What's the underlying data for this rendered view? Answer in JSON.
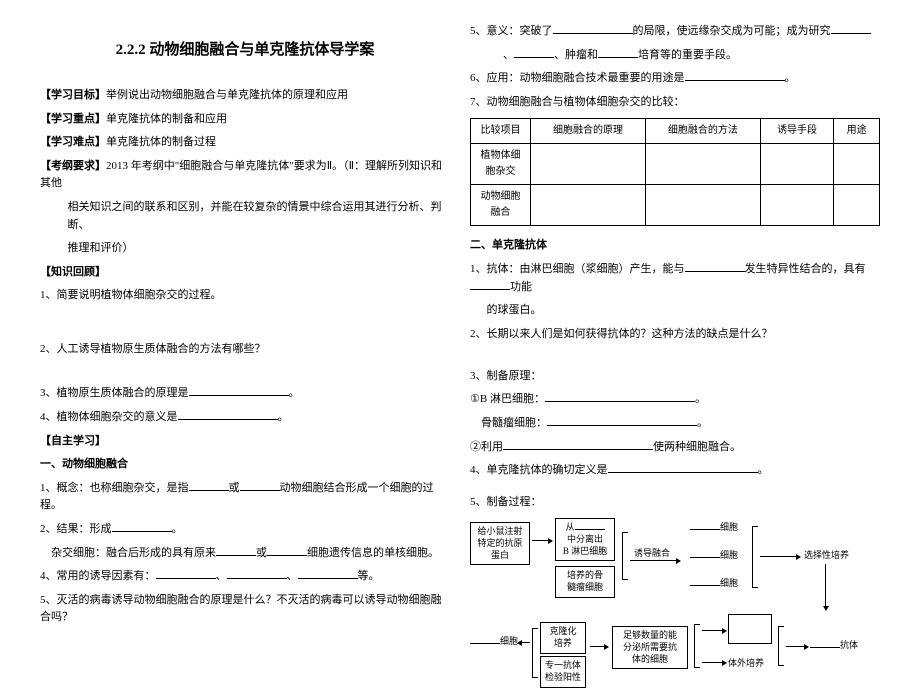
{
  "title": "2.2.2 动物细胞融合与单克隆抗体导学案",
  "left": {
    "goal_label": "【学习目标】",
    "goal": "举例说出动物细胞融合与单克隆抗体的原理和应用",
    "focus_label": "【学习重点】",
    "focus": "单克隆抗体的制备和应用",
    "diff_label": "【学习难点】",
    "diff": "单克隆抗体的制备过程",
    "req_label": "【考纲要求】",
    "req1": "2013 年考纲中\"细胞融合与单克隆抗体\"要求为Ⅱ。（Ⅱ：理解所列知识和其他",
    "req2": "相关知识之间的联系和区别，并能在较复杂的情景中综合运用其进行分析、判断、",
    "req3": "推理和评价）",
    "review_label": "【知识回顾】",
    "q1": "1、简要说明植物体细胞杂交的过程。",
    "q2": "2、人工诱导植物原生质体融合的方法有哪些？",
    "q3a": "3、植物原生质体融合的原理是",
    "q3b": "。",
    "q4a": "4、植物体细胞杂交的意义是",
    "q4b": "。",
    "self_label": "【自主学习】",
    "s1_title": "一、动物细胞融合",
    "s1_1a": "1、概念：也称细胞杂交，是指",
    "s1_1b": "或",
    "s1_1c": "动物细胞结合形成一个细胞的过程。",
    "s1_2a": "2、结果：形成",
    "s1_2b": "。",
    "s1_2c": "杂交细胞：融合后形成的具有原来",
    "s1_2d": "或",
    "s1_2e": "细胞遗传信息的单核细胞。",
    "s1_4a": "4、常用的诱导因素有：",
    "s1_4b": "、",
    "s1_4c": "、",
    "s1_4d": "等。",
    "s1_5": "5、灭活的病毒诱导动物细胞融合的原理是什么？不灭活的病毒可以诱导动物细胞融合吗？"
  },
  "right": {
    "r5a": "5、意义：突破了",
    "r5b": "的局限，使远缘杂交成为可能；成为研究",
    "r5c": "、",
    "r5d": "、肿瘤和",
    "r5e": "培育等的重要手段。",
    "r6a": "6、应用：动物细胞融合技术最重要的用途是",
    "r6b": "。",
    "r7": "7、动物细胞融合与植物体细胞杂交的比较：",
    "table": {
      "hdr": [
        "比较项目",
        "细胞融合的原理",
        "细胞融合的方法",
        "诱导手段",
        "用途"
      ],
      "row1": "植物体细胞杂交",
      "row2": "动物细胞融合"
    },
    "s2_title": "二、单克隆抗体",
    "s2_1a": "1、抗体：由淋巴细胞（浆细胞）产生，能与",
    "s2_1b": "发生特异性结合的，具有",
    "s2_1c": "功能",
    "s2_1d": "的球蛋白。",
    "s2_2": "2、长期以来人们是如何获得抗体的？这种方法的缺点是什么？",
    "s2_3": "3、制备原理：",
    "s2_3_1a": "①B 淋巴细胞：",
    "s2_3_1b": "。",
    "s2_3_1c": "骨髓瘤细胞：",
    "s2_3_1d": "。",
    "s2_3_2a": "②利用",
    "s2_3_2b": "使两种细胞融合。",
    "s2_4a": "4、单克隆抗体的确切定义是",
    "s2_4b": "。",
    "s2_5": "5、制备过程：",
    "flow": {
      "box1": "给小鼠注射\n特定的抗原\n蛋白",
      "box2a": "从",
      "box2b": "中分离出",
      "box2c": "B 淋巴细胞",
      "box3": "培养的骨\n髓瘤细胞",
      "label_induce": "诱导融合",
      "cell_suffix": "细胞",
      "select": "选择性培养",
      "box4": "细胞",
      "box5": "克隆化\n培养",
      "box6": "专一抗体\n检验阳性",
      "box7": "足够数量的能\n分泌所需要抗\n体的细胞",
      "in_vitro": "体外培养",
      "antibody": "抗体"
    }
  }
}
